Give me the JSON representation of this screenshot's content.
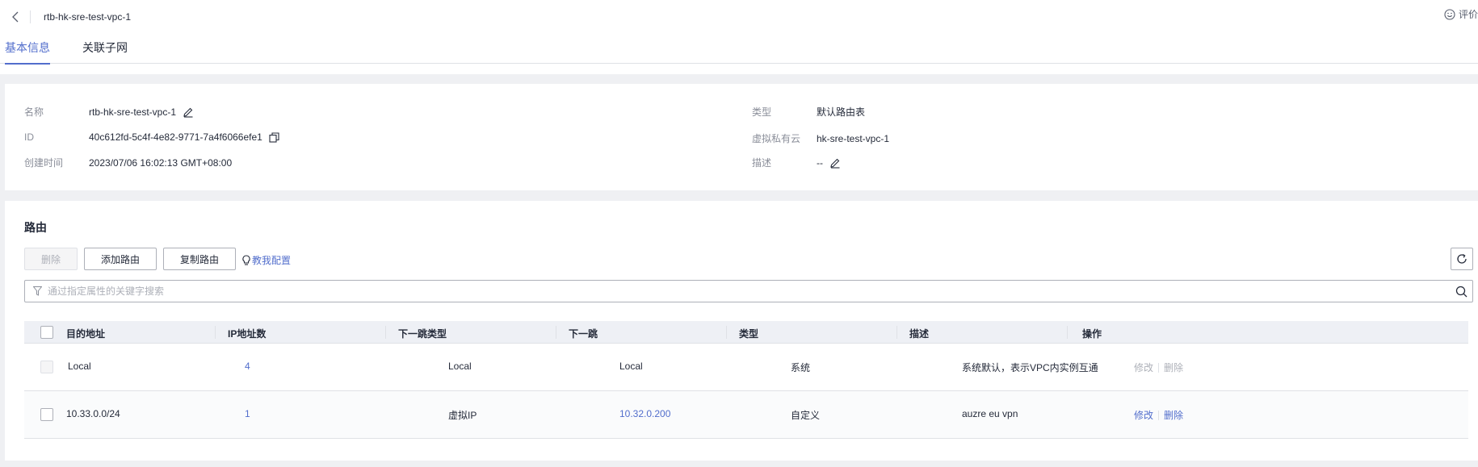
{
  "header": {
    "title": "rtb-hk-sre-test-vpc-1",
    "feedback_label": "评价"
  },
  "tabs": [
    {
      "label": "基本信息",
      "active": true
    },
    {
      "label": "关联子网",
      "active": false
    }
  ],
  "info": {
    "name_label": "名称",
    "name_value": "rtb-hk-sre-test-vpc-1",
    "id_label": "ID",
    "id_value": "40c612fd-5c4f-4e82-9771-7a4f6066efe1",
    "created_label": "创建时间",
    "created_value": "2023/07/06 16:02:13 GMT+08:00",
    "type_label": "类型",
    "type_value": "默认路由表",
    "vpc_label": "虚拟私有云",
    "vpc_value": "hk-sre-test-vpc-1",
    "desc_label": "描述",
    "desc_value": "--"
  },
  "routes": {
    "section_title": "路由",
    "delete_label": "删除",
    "add_label": "添加路由",
    "copy_label": "复制路由",
    "guide_label": "教我配置",
    "search_placeholder": "通过指定属性的关键字搜索",
    "columns": [
      "目的地址",
      "IP地址数",
      "下一跳类型",
      "下一跳",
      "类型",
      "描述",
      "操作"
    ],
    "rows": [
      {
        "dest": "Local",
        "ip_count": "4",
        "next_hop_type": "Local",
        "next_hop": "Local",
        "type": "系统",
        "desc": "系统默认，表示VPC内实例互通",
        "op_modify": "修改",
        "op_delete": "删除",
        "ops_enabled": false
      },
      {
        "dest": "10.33.0.0/24",
        "ip_count": "1",
        "next_hop_type": "虚拟IP",
        "next_hop": "10.32.0.200",
        "type": "自定义",
        "desc": "auzre eu vpn",
        "op_modify": "修改",
        "op_delete": "删除",
        "ops_enabled": true
      }
    ]
  },
  "colors": {
    "accent": "#526ecc",
    "page_bg": "#eff0f3",
    "text": "#252b3a",
    "muted": "#8a8e99"
  }
}
